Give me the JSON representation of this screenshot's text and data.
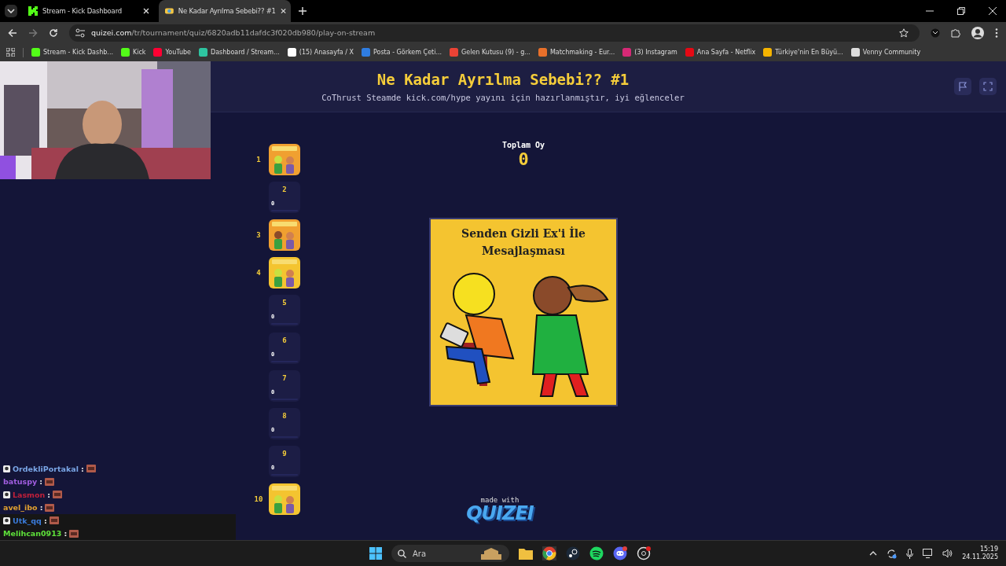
{
  "tabs": [
    {
      "title": "Stream - Kick Dashboard",
      "selected": false
    },
    {
      "title": "Ne Kadar Ayrılma Sebebi?? #1",
      "selected": true
    }
  ],
  "address": {
    "host": "quizei.com",
    "path": "/tr/tournament/quiz/6820adb11dafdc3f020db980/play-on-stream"
  },
  "bookmarks": [
    {
      "label": "Stream - Kick Dashb..."
    },
    {
      "label": "Kick"
    },
    {
      "label": "YouTube"
    },
    {
      "label": "Dashboard / Stream..."
    },
    {
      "label": "(15) Anasayfa / X"
    },
    {
      "label": "Posta - Görkem Çeti..."
    },
    {
      "label": "Gelen Kutusu (9) - g..."
    },
    {
      "label": "Matchmaking - Eur..."
    },
    {
      "label": "(3) Instagram"
    },
    {
      "label": "Ana Sayfa - Netflix"
    },
    {
      "label": "Türkiye'nin En Büyü..."
    },
    {
      "label": "Venny Community"
    }
  ],
  "page": {
    "title": "Ne Kadar Ayrılma Sebebi?? #1",
    "subtitle": "CoThrust Steamde kick.com/hype yayını için hazırlanmıştır, iyi eğlenceler",
    "total_label": "Toplam Oy",
    "total_value": "0",
    "card": {
      "caption": "Senden Gizli Ex'i İle Mesajlaşması"
    },
    "entries": [
      {
        "number": "1"
      },
      {
        "number": "2",
        "kind": "empty",
        "votes": "0"
      },
      {
        "number": "3"
      },
      {
        "number": "4"
      },
      {
        "number": "5",
        "kind": "empty",
        "votes": "0"
      },
      {
        "number": "6",
        "kind": "empty",
        "votes": "0"
      },
      {
        "number": "7",
        "kind": "empty",
        "votes": "0"
      },
      {
        "number": "8",
        "kind": "empty",
        "votes": "0"
      },
      {
        "number": "9",
        "kind": "empty",
        "votes": "0"
      },
      {
        "number": "10"
      }
    ],
    "made_with": "made with",
    "logo": "QUIZEI"
  },
  "chat": [
    {
      "user": "OrdekliPortakal",
      "sep": ":",
      "color": "#7aa6e6",
      "badge": true
    },
    {
      "user": "batuspy",
      "sep": ":",
      "color": "#a15ee0",
      "badge": false
    },
    {
      "user": "Lasmon",
      "sep": ":",
      "color": "#c0203a",
      "badge": true
    },
    {
      "user": "avel_ibo",
      "sep": ":",
      "color": "#e0a030",
      "badge": false
    },
    {
      "user": "Utk_qq",
      "sep": ":",
      "color": "#3a7ad8",
      "badge": true
    },
    {
      "user": "Melihcan0913",
      "sep": ":",
      "color": "#5ee03a",
      "badge": false
    }
  ],
  "taskbar": {
    "search_placeholder": "Ara",
    "time": "15:19",
    "date": "24.11.2025"
  }
}
